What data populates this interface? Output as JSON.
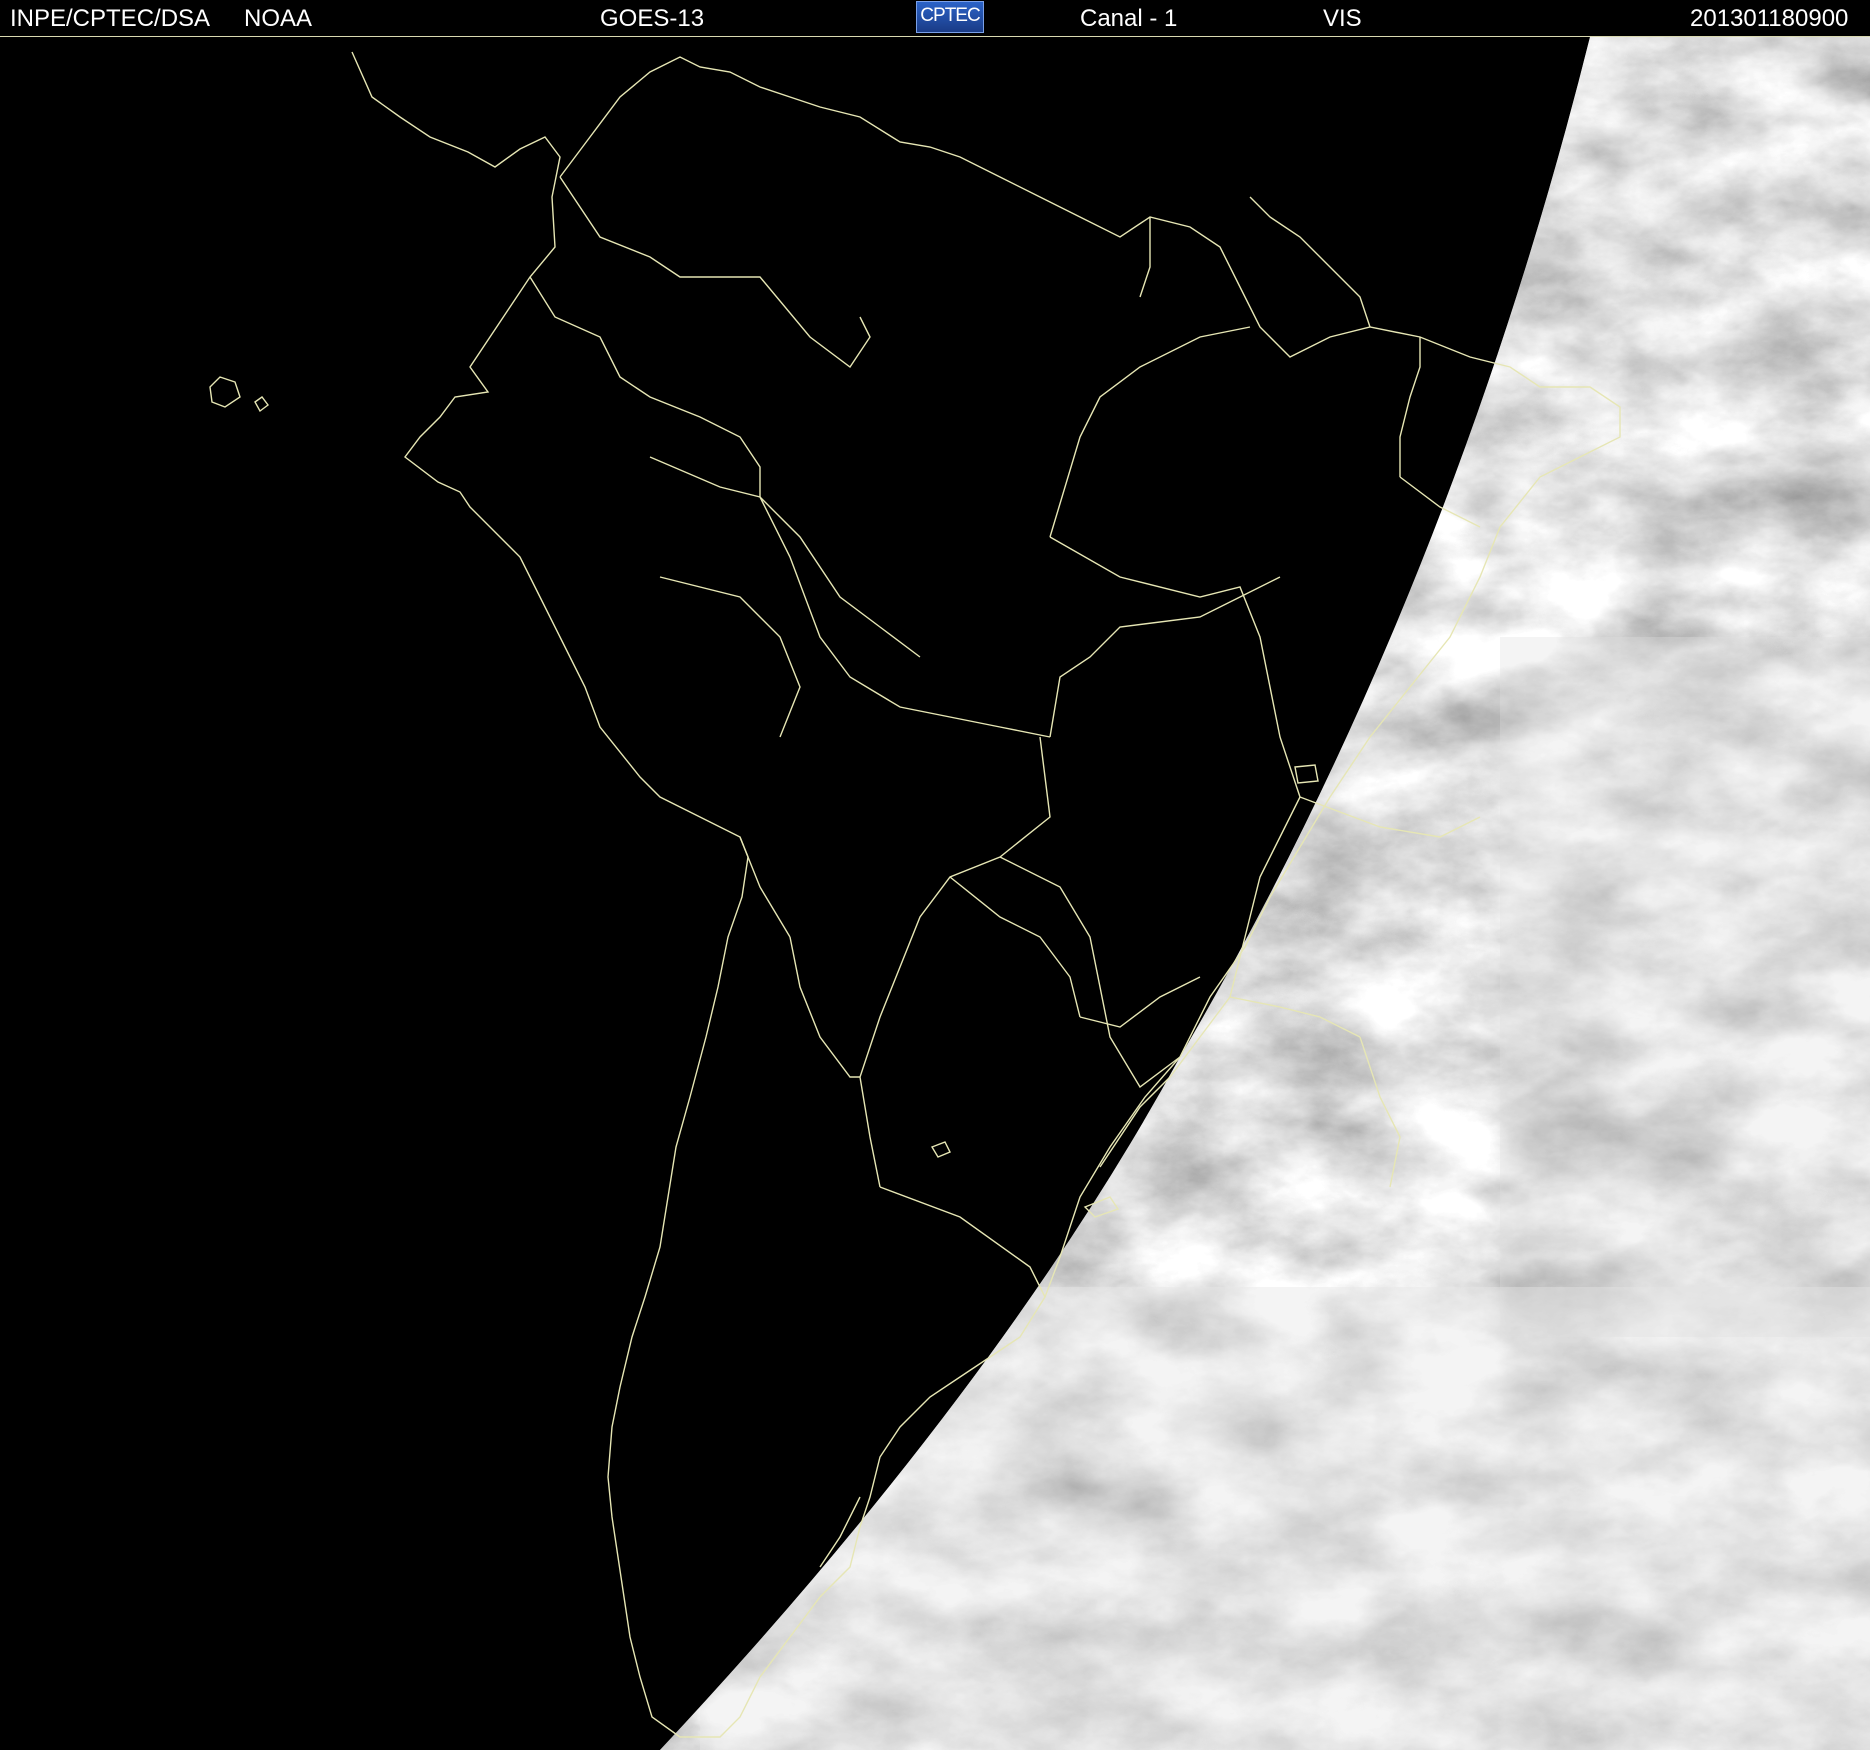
{
  "header": {
    "agency": "INPE/CPTEC/DSA",
    "provider": "NOAA",
    "satellite": "GOES-13",
    "logo_text": "CPTEC",
    "channel": "Canal - 1",
    "band": "VIS",
    "timestamp": "201301180900"
  },
  "colors": {
    "background": "#000000",
    "borders": "#e6e6b4",
    "header_text": "#ffffff",
    "logo": "#2b63c8"
  }
}
